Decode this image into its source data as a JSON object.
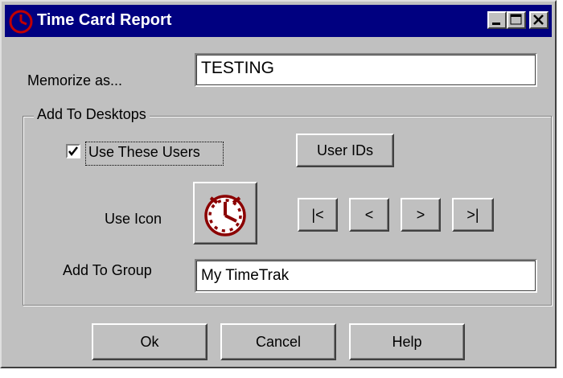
{
  "window": {
    "title": "Time Card Report",
    "controls": [
      "minimize",
      "maximize",
      "close"
    ]
  },
  "memorize": {
    "label": "Memorize as...",
    "value": "TESTING"
  },
  "desktops": {
    "group_title": "Add To Desktops",
    "use_users_label": "Use These Users",
    "use_users_checked": true,
    "user_ids_button": "User IDs",
    "use_icon_label": "Use Icon",
    "icon_name": "clock-icon",
    "nav": {
      "first": "|<",
      "prev": "<",
      "next": ">",
      "last": ">|"
    },
    "add_group_label": "Add To Group",
    "add_group_value": "My TimeTrak"
  },
  "buttons": {
    "ok": "Ok",
    "cancel": "Cancel",
    "help": "Help"
  },
  "colors": {
    "titlebar": "#000080",
    "face": "#c0c0c0",
    "icon": "#8b0000"
  }
}
